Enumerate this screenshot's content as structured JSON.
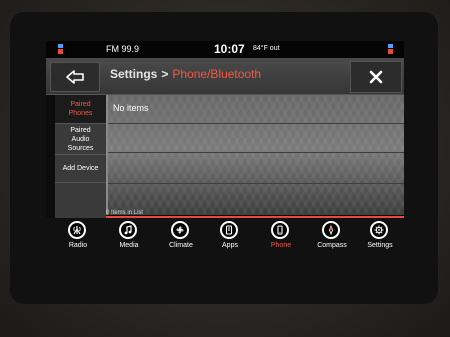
{
  "status_bar": {
    "radio": "FM 99.9",
    "clock": "10:07",
    "temperature": "84°F out"
  },
  "header": {
    "back_icon": "back-arrow-icon",
    "title": "Settings",
    "separator": ">",
    "current": "Phone/Bluetooth",
    "close_icon": "close-icon"
  },
  "sidebar": {
    "items": [
      {
        "label": "Paired Phones",
        "active": true
      },
      {
        "label": "Paired Audio Sources",
        "active": false
      },
      {
        "label": "Add Device",
        "active": false
      }
    ]
  },
  "main": {
    "empty_text": "No items",
    "count_text": "0 Items in List"
  },
  "nav": {
    "items": [
      {
        "label": "Radio",
        "icon": "radio-icon"
      },
      {
        "label": "Media",
        "icon": "media-icon"
      },
      {
        "label": "Climate",
        "icon": "climate-icon"
      },
      {
        "label": "Apps",
        "icon": "apps-icon"
      },
      {
        "label": "Phone",
        "icon": "phone-icon",
        "active": true
      },
      {
        "label": "Compass",
        "icon": "compass-icon"
      },
      {
        "label": "Settings",
        "icon": "settings-icon"
      }
    ]
  },
  "colors": {
    "accent": "#ef5a45",
    "divider": "#e84b3a"
  }
}
